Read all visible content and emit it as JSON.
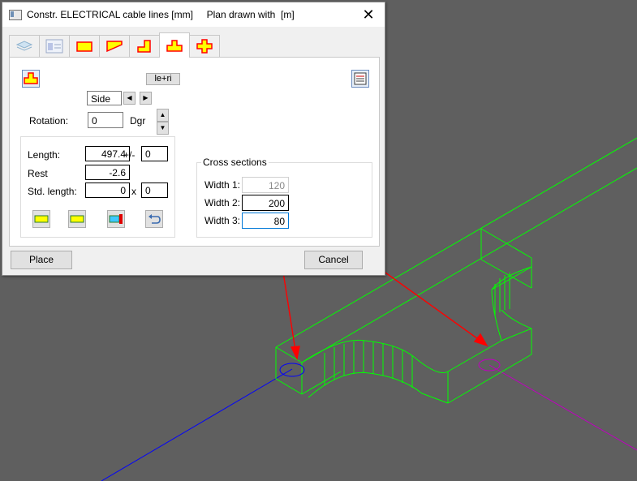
{
  "window": {
    "title": "Constr. ELECTRICAL cable lines [mm]     Plan drawn with  [m]",
    "close_glyph": "✕"
  },
  "tabs": [
    {
      "icon": "layers-icon",
      "active": false
    },
    {
      "icon": "list-window-icon",
      "active": false
    },
    {
      "icon": "rectangle-shape-icon",
      "active": false
    },
    {
      "icon": "wedge-shape-icon",
      "active": false
    },
    {
      "icon": "l-shape-icon",
      "active": false
    },
    {
      "icon": "t-shape-icon",
      "active": true
    },
    {
      "icon": "cross-shape-icon",
      "active": false
    }
  ],
  "panel": {
    "mode_button_label": "le+ri",
    "side_value": "Side",
    "rotation": {
      "label": "Rotation:",
      "value": "0",
      "unit": "Dgr"
    },
    "length": {
      "label": "Length:",
      "value": "497.4",
      "pm_label": "+/-",
      "tolerance": "0"
    },
    "rest": {
      "label": "Rest",
      "value": "-2.6"
    },
    "std_length": {
      "label": "Std. length:",
      "value": "0",
      "times_label": "x",
      "count": "0"
    },
    "cross_sections": {
      "title": "Cross sections",
      "width1": {
        "label": "Width 1:",
        "value": "120"
      },
      "width2": {
        "label": "Width 2:",
        "value": "200"
      },
      "width3": {
        "label": "Width 3:",
        "value": "80"
      }
    }
  },
  "footer": {
    "place_label": "Place",
    "cancel_label": "Cancel"
  },
  "colors": {
    "background": "#5f5f5f",
    "wireframe": "#00ff00",
    "arrow": "#ff0000",
    "axis_blue": "#0000ff",
    "axis_magenta": "#c000c0",
    "shape_fill": "#ffff00",
    "shape_stroke": "#ff0000"
  }
}
